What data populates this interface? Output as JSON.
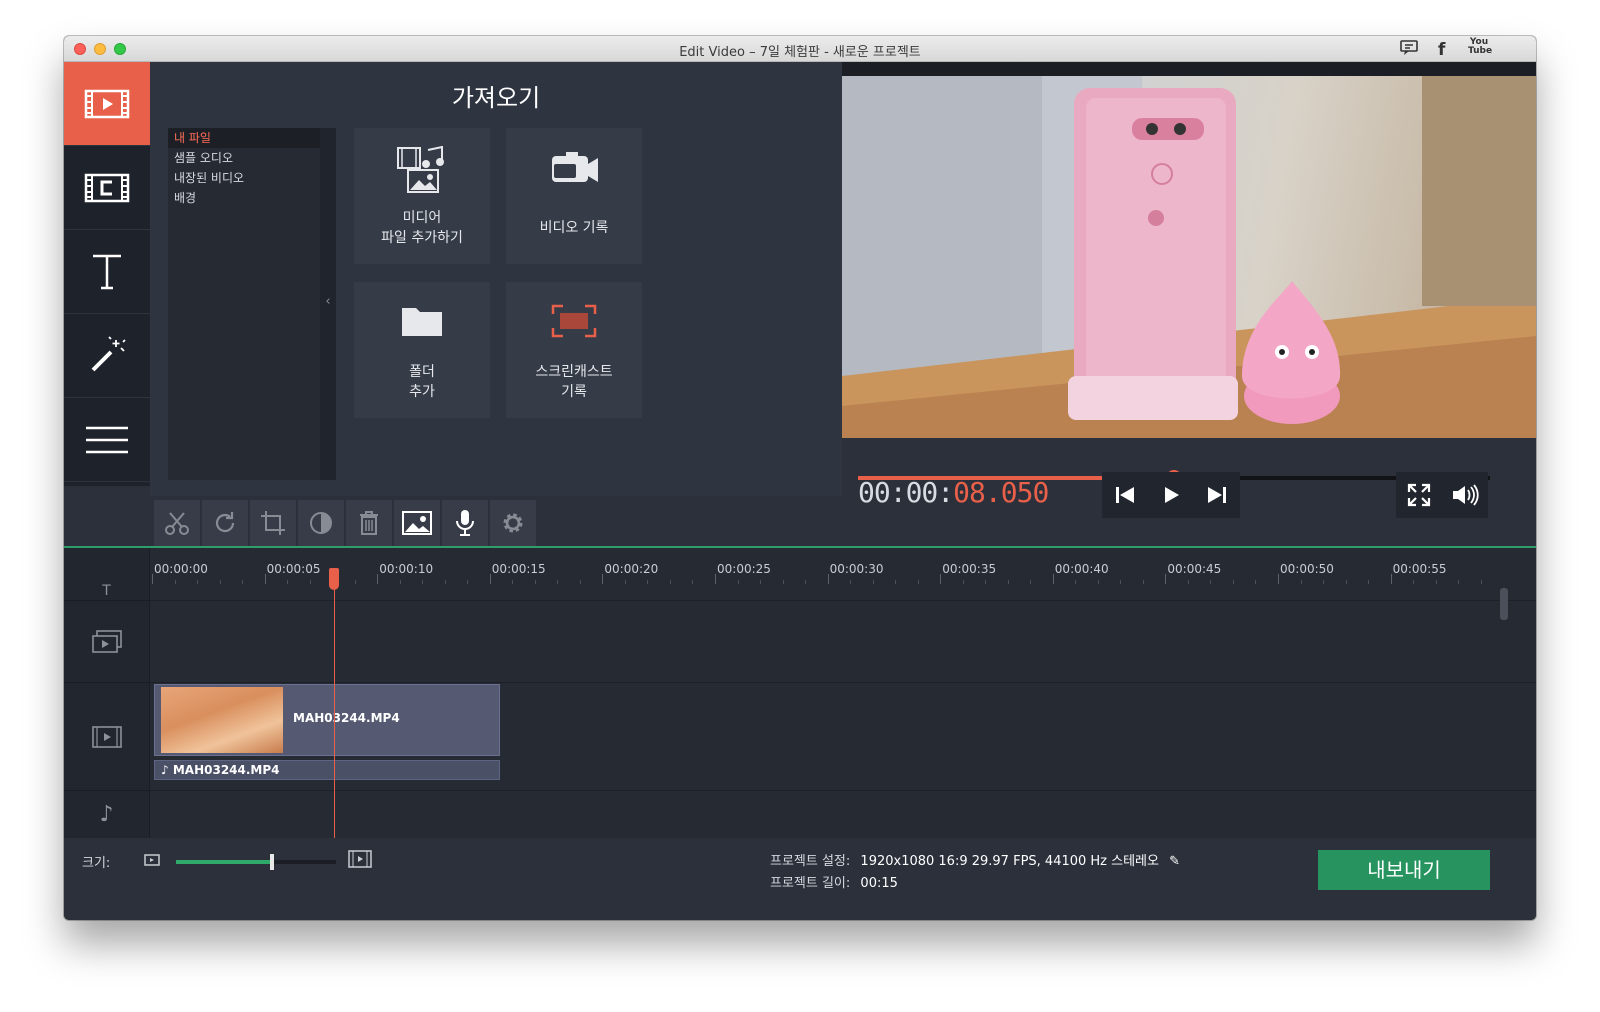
{
  "window": {
    "title": "Edit Video – 7일 체험판 - 새로운 프로젝트"
  },
  "social": {
    "youtube_label": "You\nTube"
  },
  "sidebar": {
    "items": [
      {
        "name": "import",
        "icon": "film-play-icon",
        "active": true
      },
      {
        "name": "filters",
        "icon": "film-c-icon"
      },
      {
        "name": "titles",
        "icon": "text-icon"
      },
      {
        "name": "effects",
        "icon": "magic-wand-icon"
      },
      {
        "name": "more",
        "icon": "menu-icon"
      }
    ]
  },
  "import_panel": {
    "title": "가져오기",
    "files": [
      "내 파일",
      "샘플 오디오",
      "내장된 비디오",
      "배경"
    ],
    "collapse_glyph": "‹",
    "tiles": [
      {
        "line1": "미디어",
        "line2": "파일 추가하기"
      },
      {
        "line1": "비디오 기록",
        "line2": ""
      },
      {
        "line1": "폴더",
        "line2": "추가"
      },
      {
        "line1": "스크린캐스트",
        "line2": "기록"
      }
    ]
  },
  "player": {
    "timecode_main": "00:00:",
    "timecode_accent": "08.050",
    "progress": 0.5,
    "colors": {
      "accent": "#e8604a",
      "green": "#279460"
    }
  },
  "timeline": {
    "ticks": [
      "00:00:00",
      "00:00:05",
      "00:00:10",
      "00:00:15",
      "00:00:20",
      "00:00:25",
      "00:00:30",
      "00:00:35",
      "00:00:40",
      "00:00:45",
      "00:00:50",
      "00:00:55"
    ],
    "video_clip": "MAH03244.MP4",
    "audio_clip": "MAH03244.MP4"
  },
  "bottom": {
    "size_label": "크기:",
    "zoom_level": 0.6,
    "settings_label": "프로젝트 설정:",
    "settings_value": "1920x1080 16:9 29.97 FPS, 44100 Hz 스테레오",
    "length_label": "프로젝트 길이:",
    "length_value": "00:15",
    "export_label": "내보내기"
  }
}
